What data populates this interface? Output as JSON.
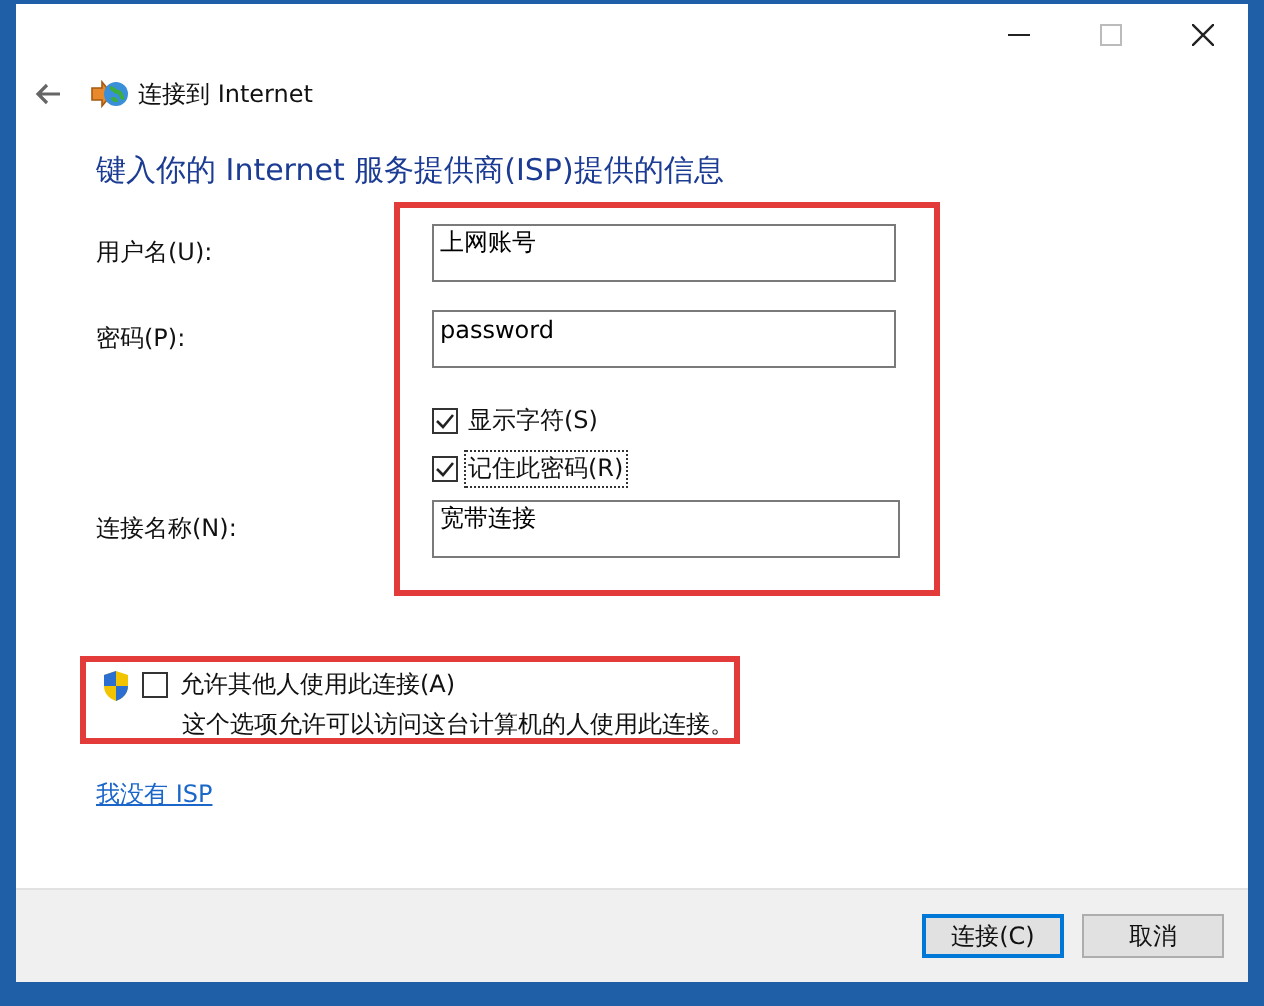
{
  "window": {
    "title": "连接到 Internet"
  },
  "heading": "键入你的 Internet 服务提供商(ISP)提供的信息",
  "fields": [
    {
      "label": "用户名(U):",
      "value": "上网账号"
    },
    {
      "label": "密码(P):",
      "value": "password"
    }
  ],
  "options": [
    {
      "label": "显示字符(S)",
      "checked": true,
      "focused": false
    },
    {
      "label": "记住此密码(R)",
      "checked": true,
      "focused": true
    }
  ],
  "connection_name": {
    "label": "连接名称(N):",
    "value": "宽带连接"
  },
  "allow_others": {
    "label": "允许其他人使用此连接(A)",
    "checked": false,
    "description": "这个选项允许可以访问这台计算机的人使用此连接。"
  },
  "link": "我没有 ISP",
  "buttons": [
    {
      "label": "连接(C)",
      "default": true
    },
    {
      "label": "取消",
      "default": false
    }
  ]
}
